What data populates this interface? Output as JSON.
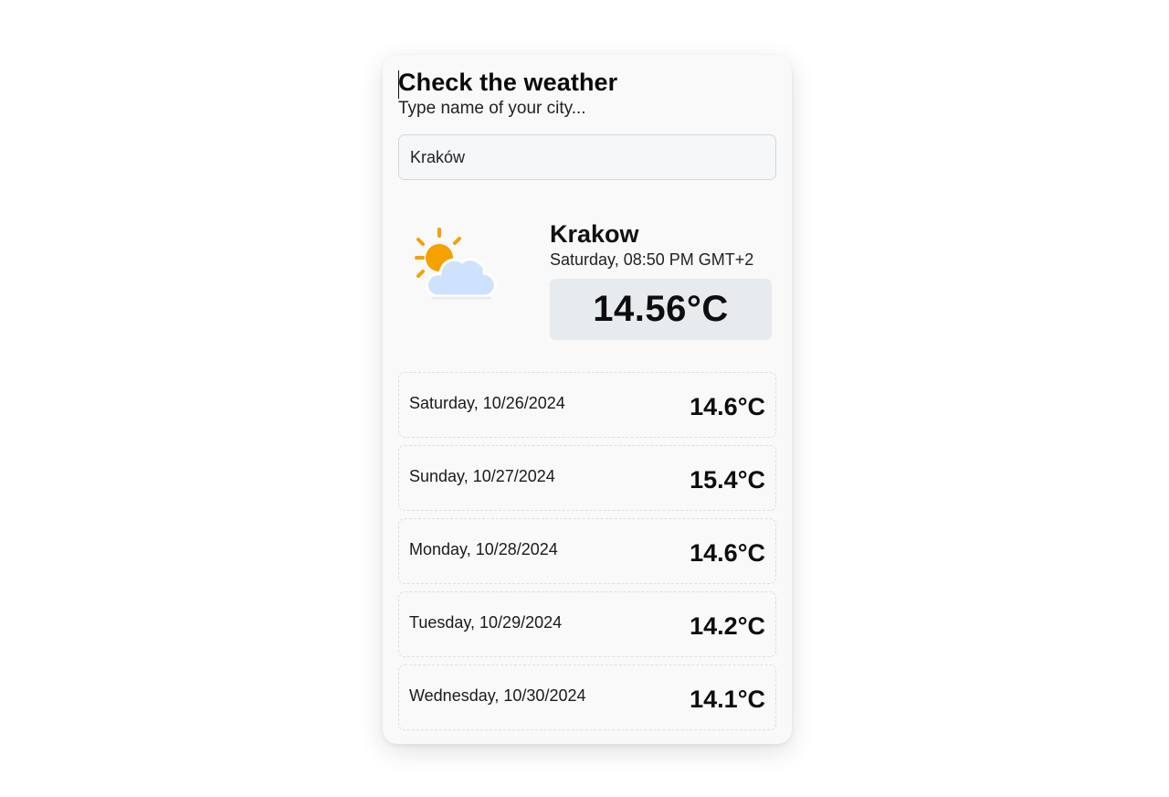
{
  "header": {
    "title": "Check the weather",
    "subtitle": "Type name of your city..."
  },
  "search": {
    "value": "Kraków"
  },
  "current": {
    "icon": "partly-cloudy-icon",
    "city": "Krakow",
    "datetime": "Saturday, 08:50 PM GMT+2",
    "temperature": "14.56°C"
  },
  "forecast": [
    {
      "date": "Saturday, 10/26/2024",
      "temp": "14.6°C"
    },
    {
      "date": "Sunday, 10/27/2024",
      "temp": "15.4°C"
    },
    {
      "date": "Monday, 10/28/2024",
      "temp": "14.6°C"
    },
    {
      "date": "Tuesday, 10/29/2024",
      "temp": "14.2°C"
    },
    {
      "date": "Wednesday, 10/30/2024",
      "temp": "14.1°C"
    }
  ],
  "colors": {
    "sun": "#f5a100",
    "cloud": "#cfe2fd",
    "temp_box": "#e8ebee",
    "card": "#f9f9f9"
  }
}
